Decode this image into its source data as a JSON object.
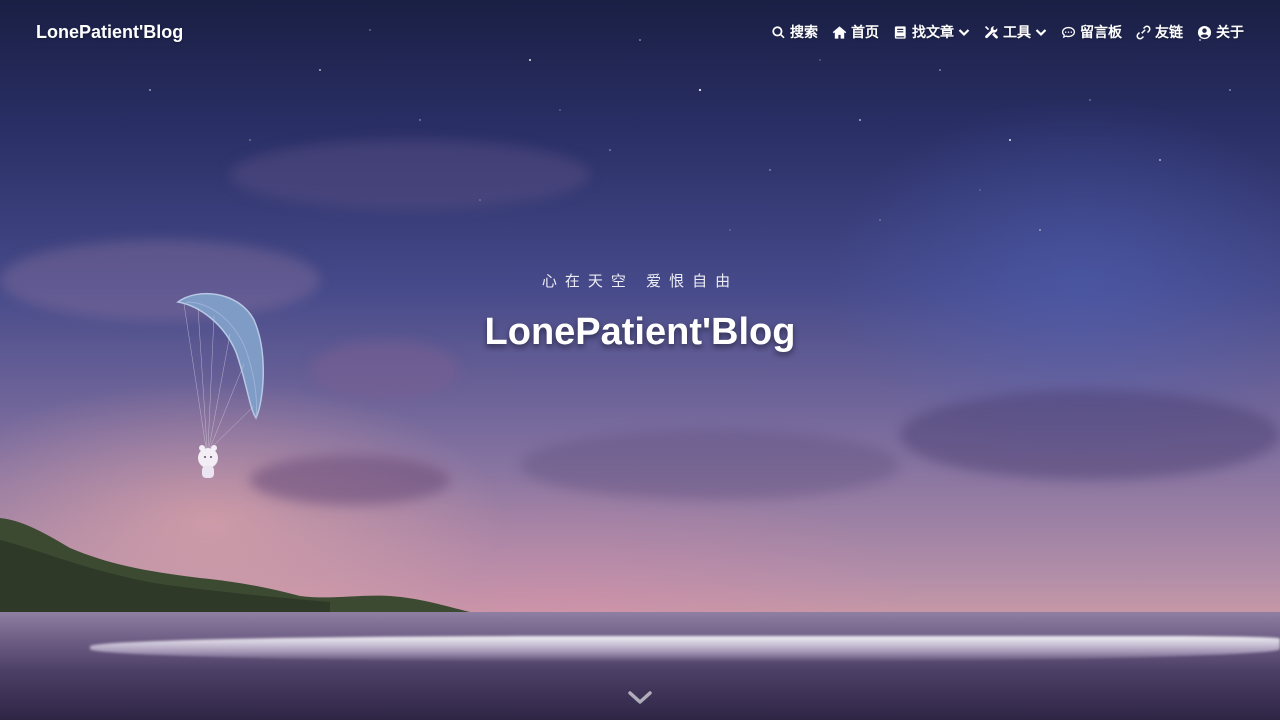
{
  "brand": {
    "name": "LonePatient'Blog"
  },
  "nav": {
    "items": [
      {
        "label": "搜索",
        "icon": "search-icon"
      },
      {
        "label": "首页",
        "icon": "home-icon"
      },
      {
        "label": "找文章",
        "icon": "book-icon",
        "dropdown": true
      },
      {
        "label": "工具",
        "icon": "tools-icon",
        "dropdown": true
      },
      {
        "label": "留言板",
        "icon": "comment-icon"
      },
      {
        "label": "友链",
        "icon": "link-icon"
      },
      {
        "label": "关于",
        "icon": "user-circle-icon"
      }
    ]
  },
  "hero": {
    "subtitle": "心在天空 爱恨自由",
    "title": "LonePatient'Blog",
    "scroll_icon": "chevron-down-icon"
  }
}
